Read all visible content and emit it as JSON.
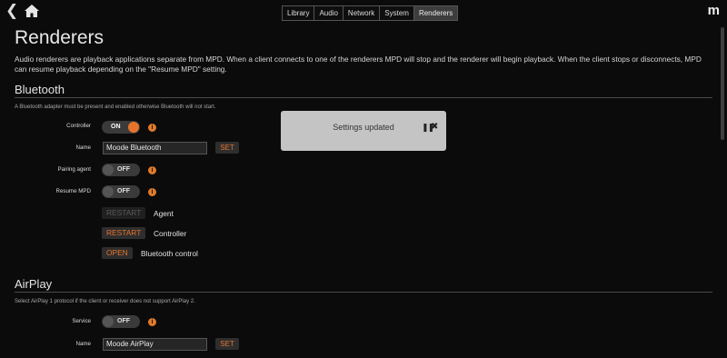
{
  "nav": {
    "back_icon": "chevron-left-icon",
    "home_icon": "home-icon",
    "logo": "m",
    "tabs": [
      {
        "label": "Library"
      },
      {
        "label": "Audio"
      },
      {
        "label": "Network"
      },
      {
        "label": "System"
      },
      {
        "label": "Renderers"
      }
    ]
  },
  "page": {
    "title": "Renderers",
    "intro": "Audio renderers are playback applications separate from MPD. When a client connects to one of the renderers MPD will stop and the renderer will begin playback. When the client stops or disconnects, MPD can resume playback depending on the \"Resume MPD\" setting."
  },
  "bluetooth": {
    "title": "Bluetooth",
    "note": "A Bluetooth adapter must be present and enabled otherwise Bluetooth will not start.",
    "controller_label": "Controller",
    "controller_state": "ON",
    "name_label": "Name",
    "name_value": "Moode Bluetooth",
    "set_label": "SET",
    "pairing_label": "Pairing agent",
    "pairing_state": "OFF",
    "resume_label": "Resume MPD",
    "resume_state": "OFF",
    "restart_agent_btn": "RESTART",
    "restart_agent_label": "Agent",
    "restart_controller_btn": "RESTART",
    "restart_controller_label": "Controller",
    "open_btn": "OPEN",
    "open_label": "Bluetooth control"
  },
  "airplay": {
    "title": "AirPlay",
    "note": "Select AirPlay 1 protocol if the client or receiver does not support AirPlay 2.",
    "service_label": "Service",
    "service_state": "OFF",
    "name_label": "Name",
    "name_value": "Moode AirPlay",
    "set_label": "SET"
  },
  "toast": {
    "message": "Settings updated",
    "pause": "❚❚",
    "close": "✖"
  },
  "colors": {
    "accent": "#e8742b",
    "background": "#0b0b0b",
    "toast_bg": "#c4c4c4"
  }
}
